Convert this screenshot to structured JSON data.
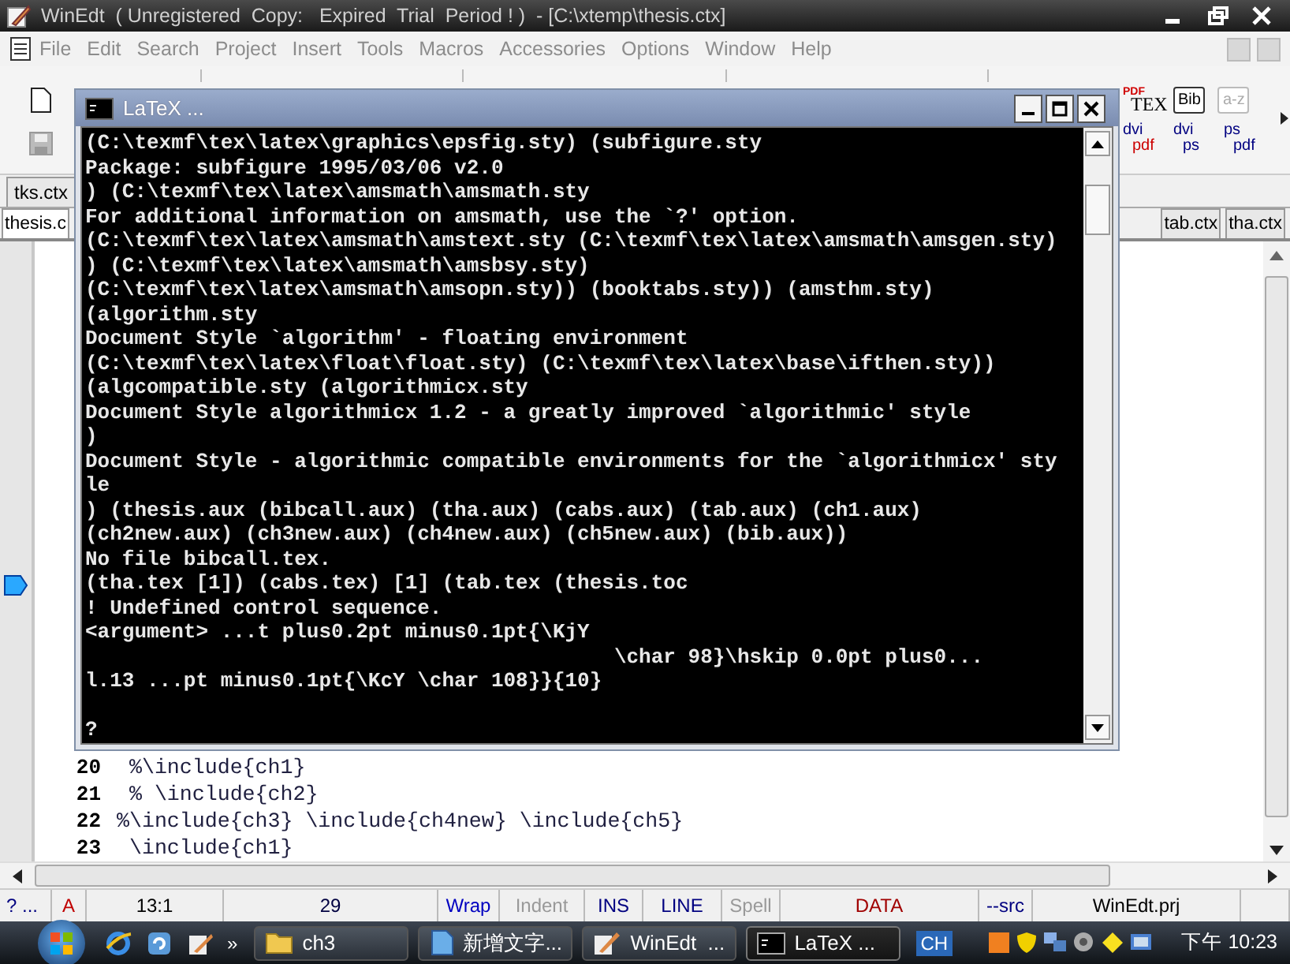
{
  "window": {
    "title": "WinEdt  ( Unregistered  Copy:   Expired  Trial  Period ! )  - [C:\\xtemp\\thesis.ctx]"
  },
  "menu": {
    "greyed": true,
    "items": [
      "File",
      "Edit",
      "Search",
      "Project",
      "Insert",
      "Tools",
      "Macros",
      "Accessories",
      "Options",
      "Window",
      "Help"
    ]
  },
  "toolbar": {
    "row1": [
      {
        "kind": "pdftex",
        "top": "PDF",
        "text": "TEX",
        "disabled": false
      },
      {
        "kind": "framed",
        "text": "Bib",
        "disabled": false
      },
      {
        "kind": "framed",
        "text": "a-z",
        "disabled": true
      }
    ],
    "row2": [
      {
        "from": "dvi",
        "to": "pdf",
        "color": "#cc0000"
      },
      {
        "from": "dvi",
        "to": "ps",
        "color": "#000080"
      },
      {
        "from": "ps",
        "to": "pdf",
        "color": "#000080"
      }
    ]
  },
  "tabs": {
    "row1": [
      {
        "label": "tks.ctx",
        "selected": false
      }
    ],
    "row2_left": [
      {
        "label": "thesis.c",
        "selected": true
      }
    ],
    "row2_right": [
      {
        "label": "tab.ctx",
        "selected": false
      },
      {
        "label": "tha.ctx",
        "selected": false
      }
    ]
  },
  "editor": {
    "lines": [
      {
        "number": "20",
        "text": " %\\include{ch1}"
      },
      {
        "number": "21",
        "text": " % \\include{ch2}"
      },
      {
        "number": "22",
        "text": "%\\include{ch3} \\include{ch4new} \\include{ch5}"
      },
      {
        "number": "23",
        "text": " \\include{ch1}"
      }
    ]
  },
  "console": {
    "title": "LaTeX ...",
    "lines": [
      "(C:\\texmf\\tex\\latex\\graphics\\epsfig.sty) (subfigure.sty",
      "Package: subfigure 1995/03/06 v2.0",
      ") (C:\\texmf\\tex\\latex\\amsmath\\amsmath.sty",
      "For additional information on amsmath, use the `?' option.",
      "(C:\\texmf\\tex\\latex\\amsmath\\amstext.sty (C:\\texmf\\tex\\latex\\amsmath\\amsgen.sty)",
      ") (C:\\texmf\\tex\\latex\\amsmath\\amsbsy.sty)",
      "(C:\\texmf\\tex\\latex\\amsmath\\amsopn.sty)) (booktabs.sty)) (amsthm.sty)",
      "(algorithm.sty",
      "Document Style `algorithm' - floating environment",
      "(C:\\texmf\\tex\\latex\\float\\float.sty) (C:\\texmf\\tex\\latex\\base\\ifthen.sty))",
      "(algcompatible.sty (algorithmicx.sty",
      "Document Style algorithmicx 1.2 - a greatly improved `algorithmic' style",
      ")",
      "Document Style - algorithmic compatible environments for the `algorithmicx' sty",
      "le",
      ") (thesis.aux (bibcall.aux) (tha.aux) (cabs.aux) (tab.aux) (ch1.aux)",
      "(ch2new.aux) (ch3new.aux) (ch4new.aux) (ch5new.aux) (bib.aux))",
      "No file bibcall.tex.",
      "(tha.tex [1]) (cabs.tex) [1] (tab.tex (thesis.toc",
      "! Undefined control sequence.",
      "<argument> ...t plus0.2pt minus0.1pt{\\KjY",
      "                                           \\char 98}\\hskip 0.0pt plus0...",
      "l.13 ...pt minus0.1pt{\\KcY \\char 108}}{10}"
    ],
    "prompt": "?"
  },
  "status_bar": [
    {
      "text": "? ...",
      "color": "#000080"
    },
    {
      "text": "A",
      "color": "#c00000"
    },
    {
      "text": "13:1",
      "color": "#000000"
    },
    {
      "text": "29",
      "color": "#000040"
    },
    {
      "text": "Wrap",
      "color": "#0000c0"
    },
    {
      "text": "Indent",
      "color": "#999999"
    },
    {
      "text": "INS",
      "color": "#000080"
    },
    {
      "text": "LINE",
      "color": "#000080"
    },
    {
      "text": "Spell",
      "color": "#999999"
    },
    {
      "text": "DATA",
      "color": "#a00000"
    },
    {
      "text": "--src",
      "color": "#000080"
    },
    {
      "text": "WinEdt.prj",
      "color": "#000000"
    }
  ],
  "taskbar": {
    "more": "»",
    "buttons": [
      {
        "kind": "folder",
        "label": "ch3",
        "selected": false
      },
      {
        "kind": "notepad",
        "label": "新增文字...",
        "selected": false
      },
      {
        "kind": "winedt",
        "label": "WinEdt  ...",
        "selected": false
      },
      {
        "kind": "console",
        "label": "LaTeX ...",
        "selected": true
      }
    ],
    "language": "CH",
    "clock": "下午 10:23"
  }
}
